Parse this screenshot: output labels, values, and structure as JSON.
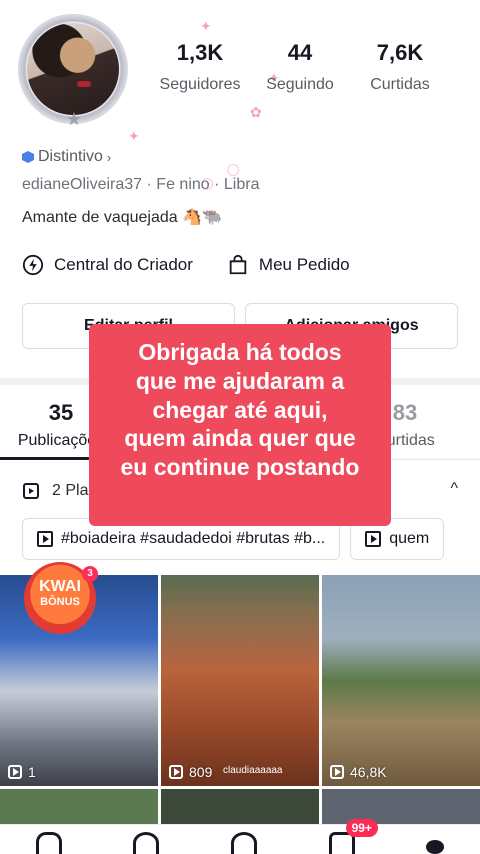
{
  "profile": {
    "stats": [
      {
        "value": "1,3K",
        "label": "Seguidores"
      },
      {
        "value": "44",
        "label": "Seguindo"
      },
      {
        "value": "7,6K",
        "label": "Curtidas"
      }
    ],
    "badge_label": "Distintivo",
    "meta_line": "edianeOliveira37 · Fe   nino · Libra",
    "bio": "Amante de vaquejada 🐴🐃"
  },
  "quick_links": {
    "creator_center": "Central do Criador",
    "my_order": "Meu Pedido"
  },
  "buttons": {
    "edit_profile": "Editar perfil",
    "add_friends": "Adicionar amigos"
  },
  "tabs": [
    {
      "count": "35",
      "label": "Publicações"
    },
    {
      "count": "",
      "label": ""
    },
    {
      "count": "83",
      "label": "Curtidas"
    }
  ],
  "playlist": {
    "label": "2 Pla",
    "chevron": "^"
  },
  "chips": [
    {
      "label": "#boiadeira #saudadedoi #brutas #b..."
    },
    {
      "label": "quem"
    }
  ],
  "videos": [
    {
      "views": "1"
    },
    {
      "views": "809",
      "overlay_text": "claudiaaaaaa"
    },
    {
      "views": "46,8K"
    }
  ],
  "kwai": {
    "title": "KWAI",
    "subtitle": "BÔNUS",
    "count": "3"
  },
  "overlay_caption": {
    "lines": [
      "Obrigada há todos",
      "que me ajudaram a",
      "chegar até aqui,",
      "quem ainda quer que",
      "eu continue postando"
    ]
  },
  "bottom_nav": {
    "inbox_badge": "99+"
  },
  "colors": {
    "overlay_bg": "#ef4a5b",
    "badge_red": "#fe2c55",
    "distintivo_blue": "#4a7fe8"
  }
}
